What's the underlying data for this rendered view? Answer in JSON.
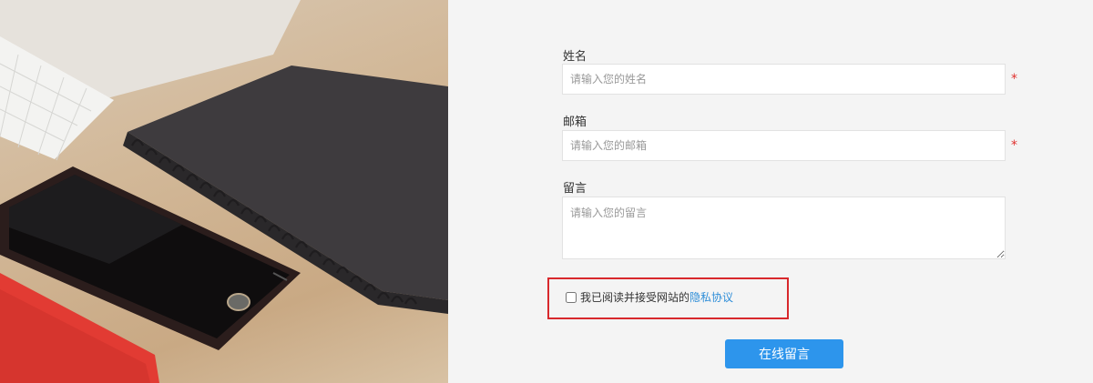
{
  "form": {
    "name": {
      "label": "姓名",
      "placeholder": "请输入您的姓名",
      "required_mark": "*"
    },
    "email": {
      "label": "邮箱",
      "placeholder": "请输入您的邮箱",
      "required_mark": "*"
    },
    "message": {
      "label": "留言",
      "placeholder": "请输入您的留言"
    },
    "consent": {
      "text": "我已阅读并接受网站的",
      "link_text": "隐私协议",
      "checked": false
    },
    "submit_label": "在线留言"
  },
  "colors": {
    "accent": "#2d95ec",
    "link": "#2f8ed8",
    "required": "#e0312f",
    "highlight_border": "#d8282c",
    "page_background": "#f4f4f4"
  }
}
